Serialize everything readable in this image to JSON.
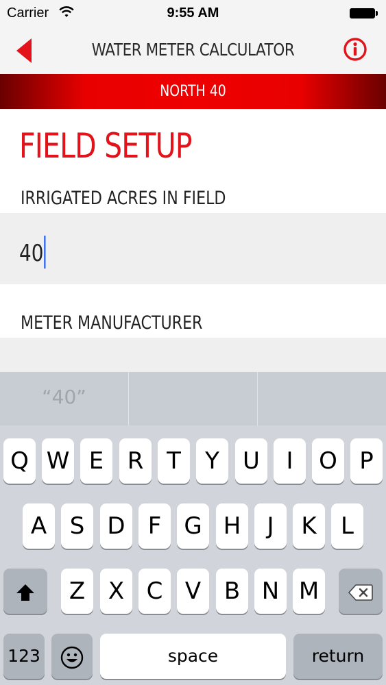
{
  "status_bar": {
    "carrier": "Carrier",
    "time": "9:55 AM"
  },
  "nav": {
    "title": "WATER METER CALCULATOR",
    "accent_color": "#e2131a"
  },
  "field_name": "NORTH 40",
  "form": {
    "heading": "FIELD SETUP",
    "acres_label": "IRRIGATED ACRES IN FIELD",
    "acres_value": "40",
    "manufacturer_label": "METER MANUFACTURER"
  },
  "keyboard": {
    "suggestions": [
      "“40”",
      "",
      ""
    ],
    "row1": [
      "Q",
      "W",
      "E",
      "R",
      "T",
      "Y",
      "U",
      "I",
      "O",
      "P"
    ],
    "row2": [
      "A",
      "S",
      "D",
      "F",
      "G",
      "H",
      "J",
      "K",
      "L"
    ],
    "row3": [
      "Z",
      "X",
      "C",
      "V",
      "B",
      "N",
      "M"
    ],
    "numbers_label": "123",
    "space_label": "space",
    "return_label": "return",
    "icons": [
      "shift-icon",
      "backspace-icon",
      "emoji-icon"
    ]
  }
}
